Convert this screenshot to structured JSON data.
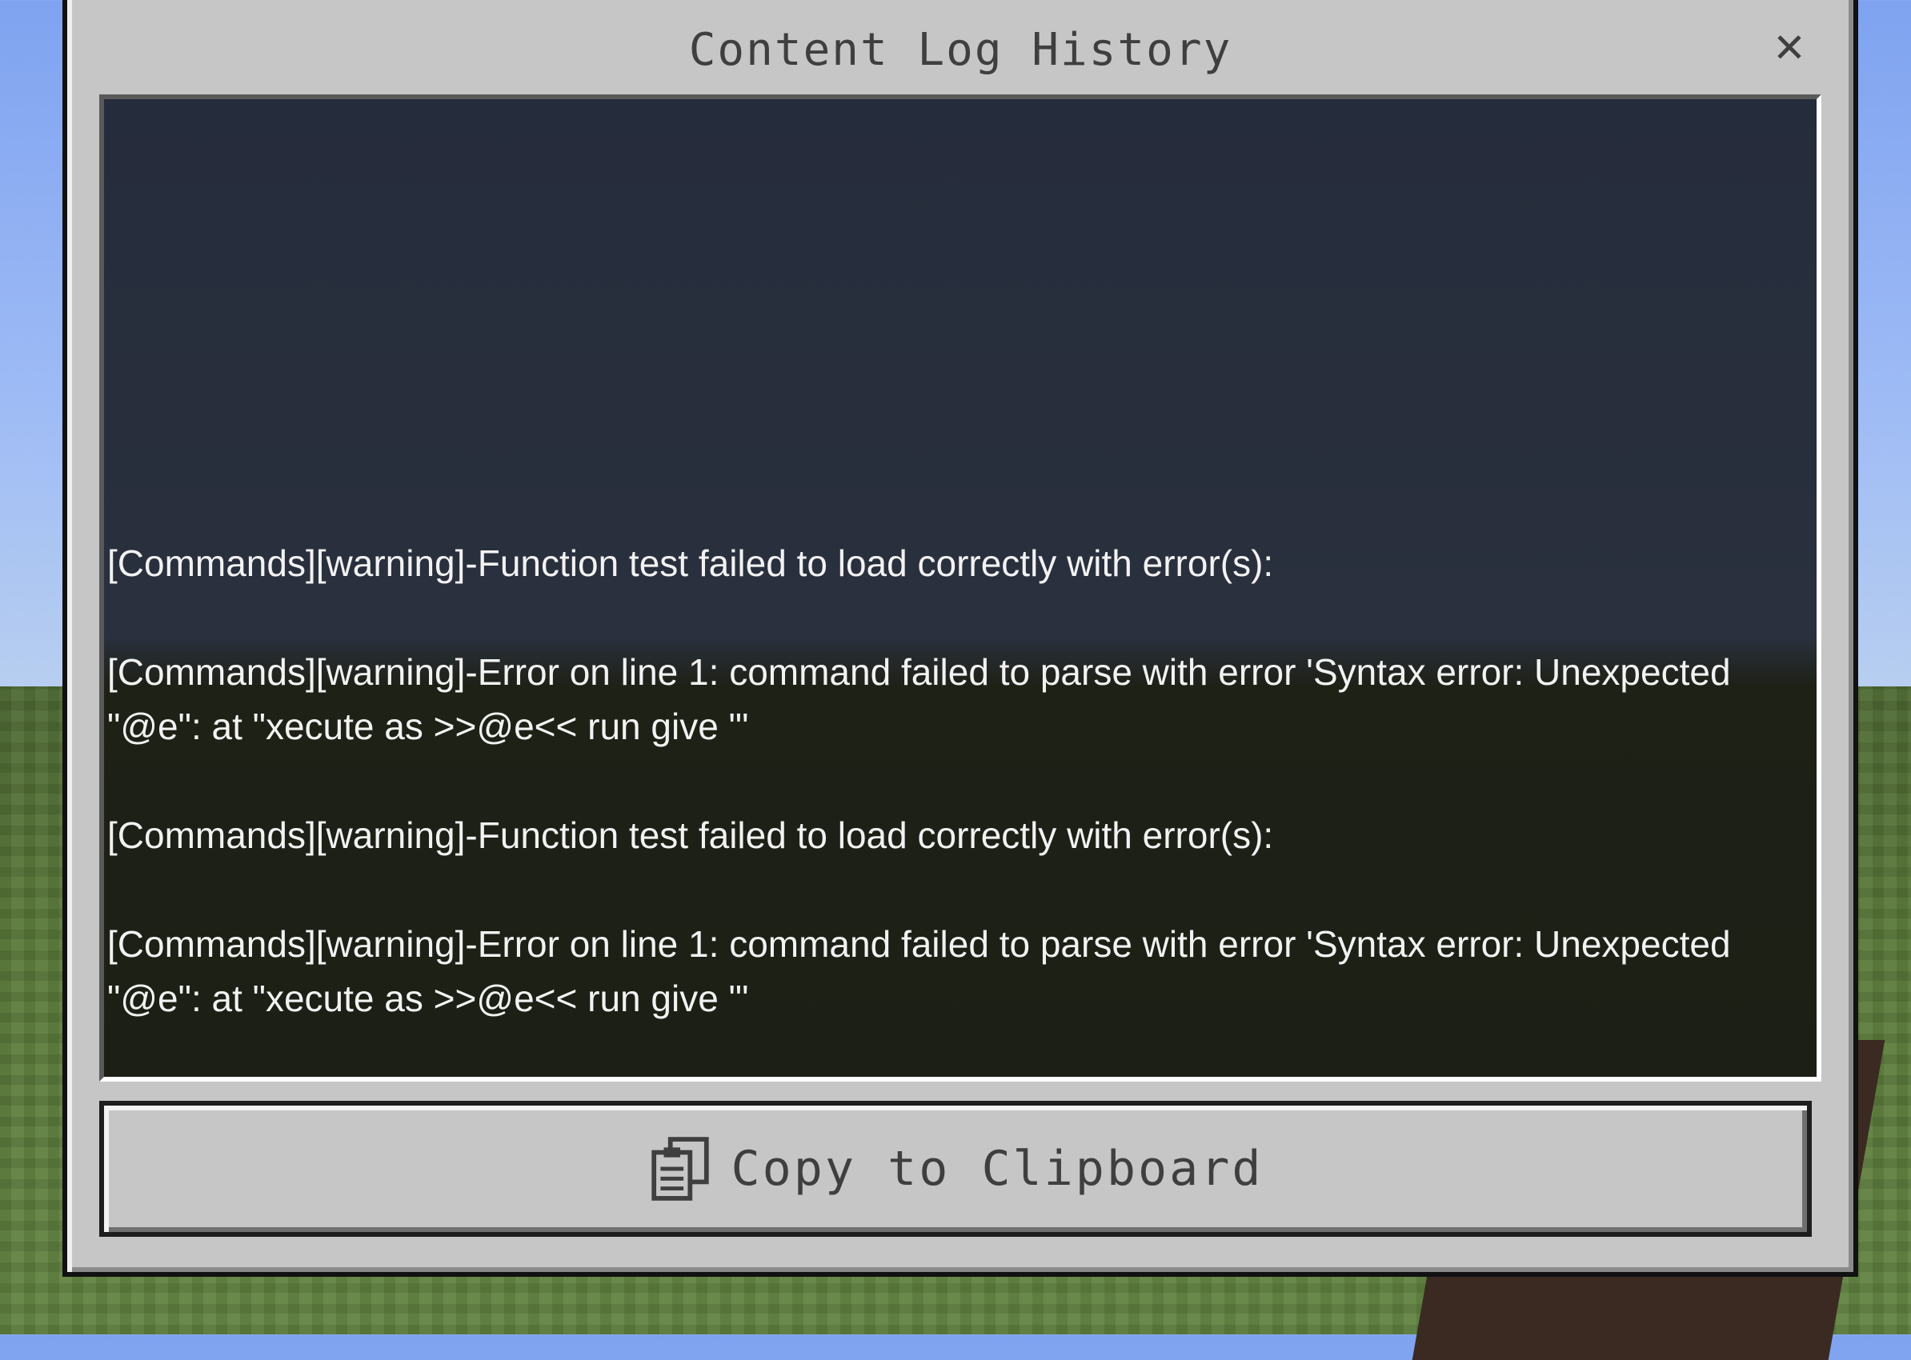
{
  "dialog": {
    "title": "Content Log History",
    "close_symbol": "✕",
    "log_entries": [
      "[Commands][warning]-Function test failed to load correctly with error(s):",
      "[Commands][warning]-Error on line 1: command failed to parse with error 'Syntax error: Unexpected \"@e\": at \"xecute as >>@e<< run give \"'",
      "[Commands][warning]-Function test failed to load correctly with error(s):",
      "[Commands][warning]-Error on line 1: command failed to parse with error 'Syntax error: Unexpected \"@e\": at \"xecute as >>@e<< run give \"'"
    ],
    "copy_button": {
      "label": "Copy to Clipboard",
      "icon": "clipboard-icon"
    }
  },
  "colors": {
    "panel": "#c6c6c6",
    "title_text": "#3f3f3f",
    "log_text": "#f2f2f2"
  }
}
